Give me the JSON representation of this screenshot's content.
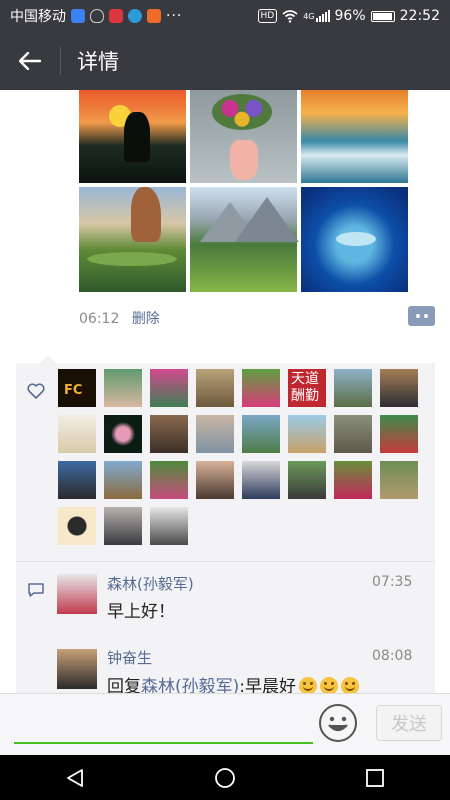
{
  "status": {
    "carrier": "中国移动",
    "hd": "HD",
    "net": "4G",
    "battery": "96%",
    "time": "22:52",
    "dots": "···"
  },
  "appbar": {
    "title": "详情"
  },
  "post": {
    "time": "06:12",
    "delete_label": "删除"
  },
  "comments": [
    {
      "name": "森林(孙毅军)",
      "time": "07:35",
      "text": "早上好！"
    },
    {
      "name": "钟奋生",
      "time": "08:08",
      "reply_prefix": "回复",
      "reply_to": "森林(孙毅军)",
      "reply_text": ":早晨好"
    }
  ],
  "input": {
    "placeholder": ""
  },
  "send_label": "发送",
  "like_badge_text": "FC",
  "calligraphy_text": "天道酬勤",
  "colors": {
    "link": "#576b95",
    "header": "#393a3f",
    "accent": "#45c01a"
  }
}
